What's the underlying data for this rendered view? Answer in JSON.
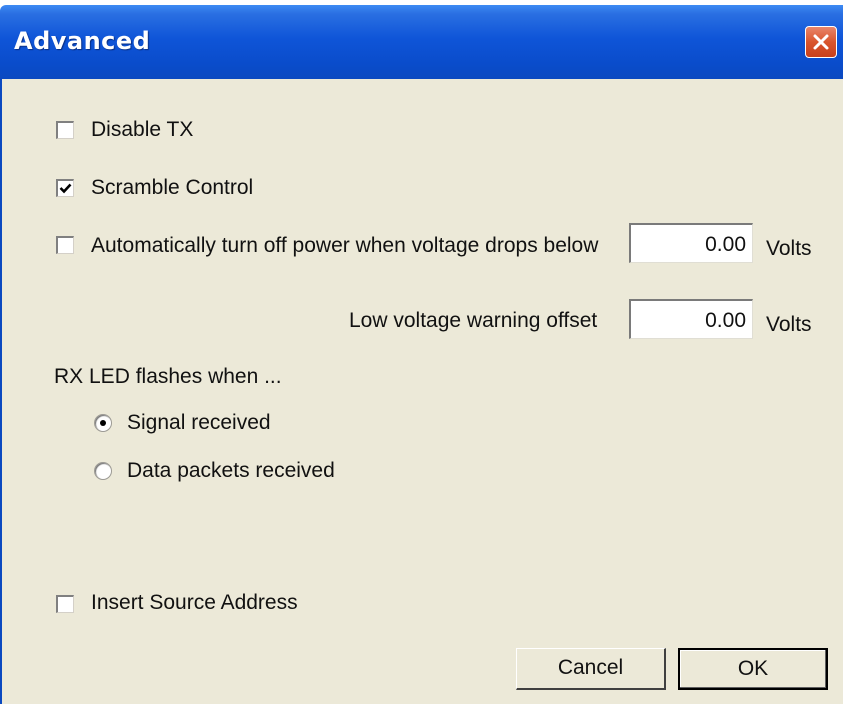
{
  "window": {
    "title": "Advanced"
  },
  "options": {
    "disable_tx": {
      "label": "Disable TX",
      "checked": false
    },
    "scramble_control": {
      "label": "Scramble Control",
      "checked": true
    },
    "auto_power_off": {
      "label": "Automatically turn off power when voltage drops below",
      "checked": false,
      "value": "0.00",
      "unit": "Volts"
    },
    "low_voltage_warning": {
      "label": "Low voltage warning offset",
      "value": "0.00",
      "unit": "Volts"
    },
    "insert_source_address": {
      "label": "Insert Source Address",
      "checked": false
    }
  },
  "rx_led": {
    "heading": "RX LED flashes when ...",
    "choices": [
      {
        "label": "Signal received",
        "selected": true
      },
      {
        "label": "Data packets received",
        "selected": false
      }
    ]
  },
  "buttons": {
    "cancel": "Cancel",
    "ok": "OK"
  },
  "icons": {
    "close": "close-icon",
    "check": "checkmark-icon"
  },
  "colors": {
    "titlebar": "#0a4ccb",
    "close_button": "#d9552d",
    "dialog_background": "#ece9d8"
  }
}
